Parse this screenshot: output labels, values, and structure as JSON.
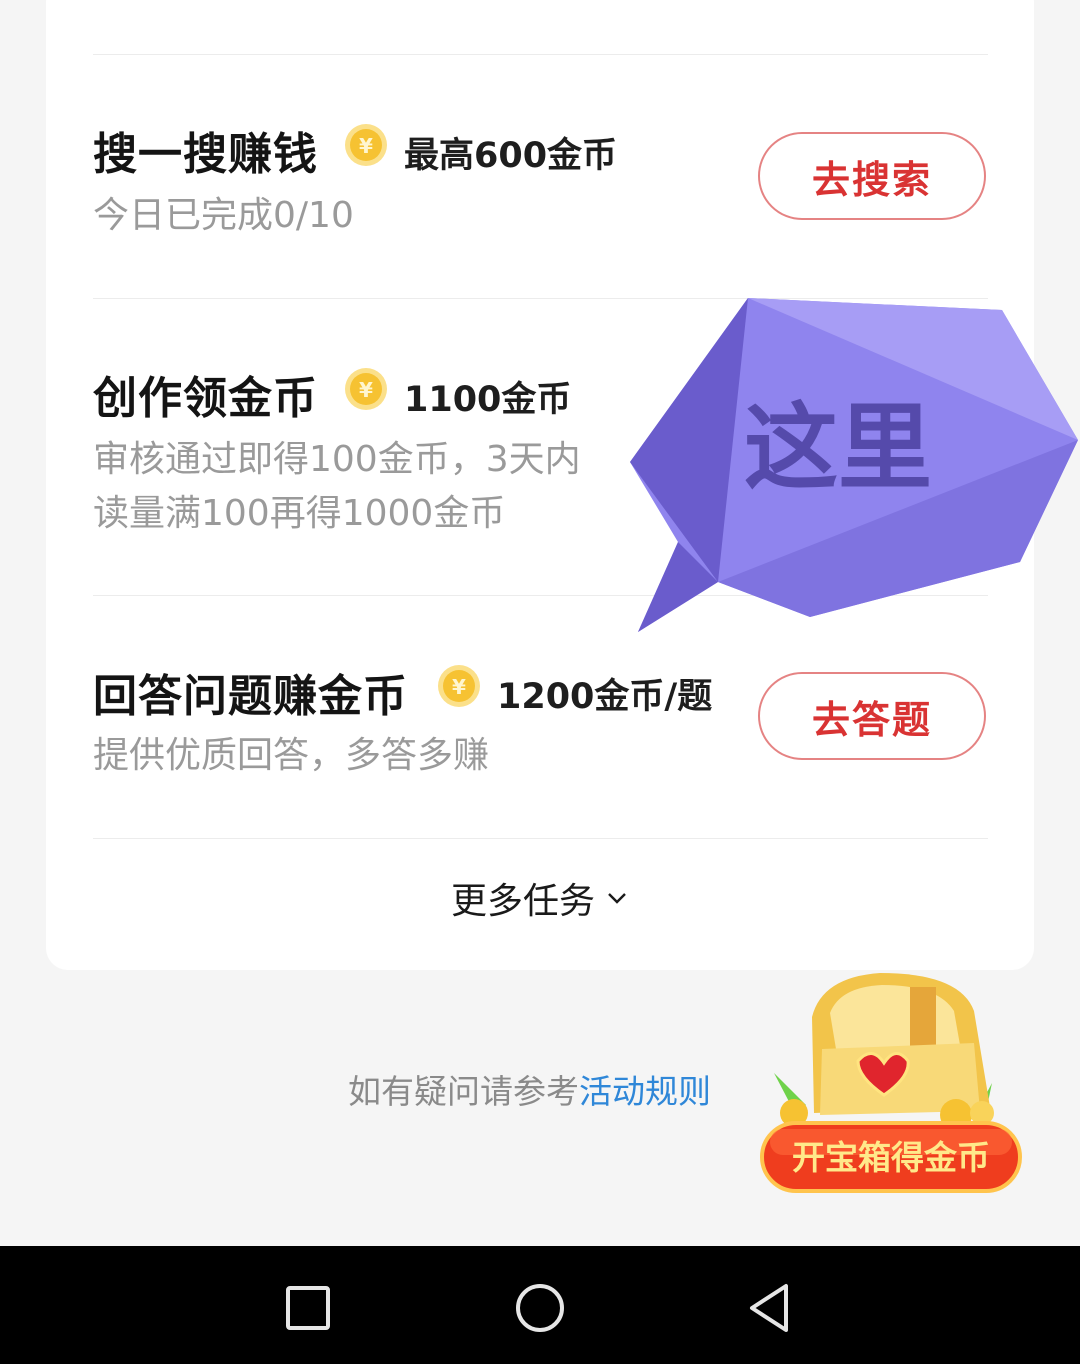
{
  "tasks": [
    {
      "title": "搜一搜赚钱",
      "reward": "最高600金币",
      "desc": [
        "今日已完成0/10"
      ],
      "button": "去搜索"
    },
    {
      "title": "创作领金币",
      "reward": "1100金币",
      "desc": [
        "审核通过即得100金币，3天内",
        "读量满100再得1000金币"
      ],
      "button": ""
    },
    {
      "title": "回答问题赚金币",
      "reward": "1200金币/题",
      "desc": [
        "提供优质回答，多答多赚"
      ],
      "button": "去答题"
    }
  ],
  "more_tasks_label": "更多任务",
  "faq": {
    "prefix": "如有疑问请参考",
    "link": "活动规则"
  },
  "sticker": {
    "text": "这里"
  },
  "treasure": {
    "label": "开宝箱得金币"
  },
  "colors": {
    "accent_red": "#d93333",
    "link_blue": "#2f87d8",
    "coin_gold": "#f6c232",
    "sticker_purple": "#8f84ee"
  },
  "icons": [
    "coin-icon",
    "chevron-down-icon",
    "recent-apps-icon",
    "home-icon",
    "back-icon",
    "treasure-chest-icon"
  ]
}
